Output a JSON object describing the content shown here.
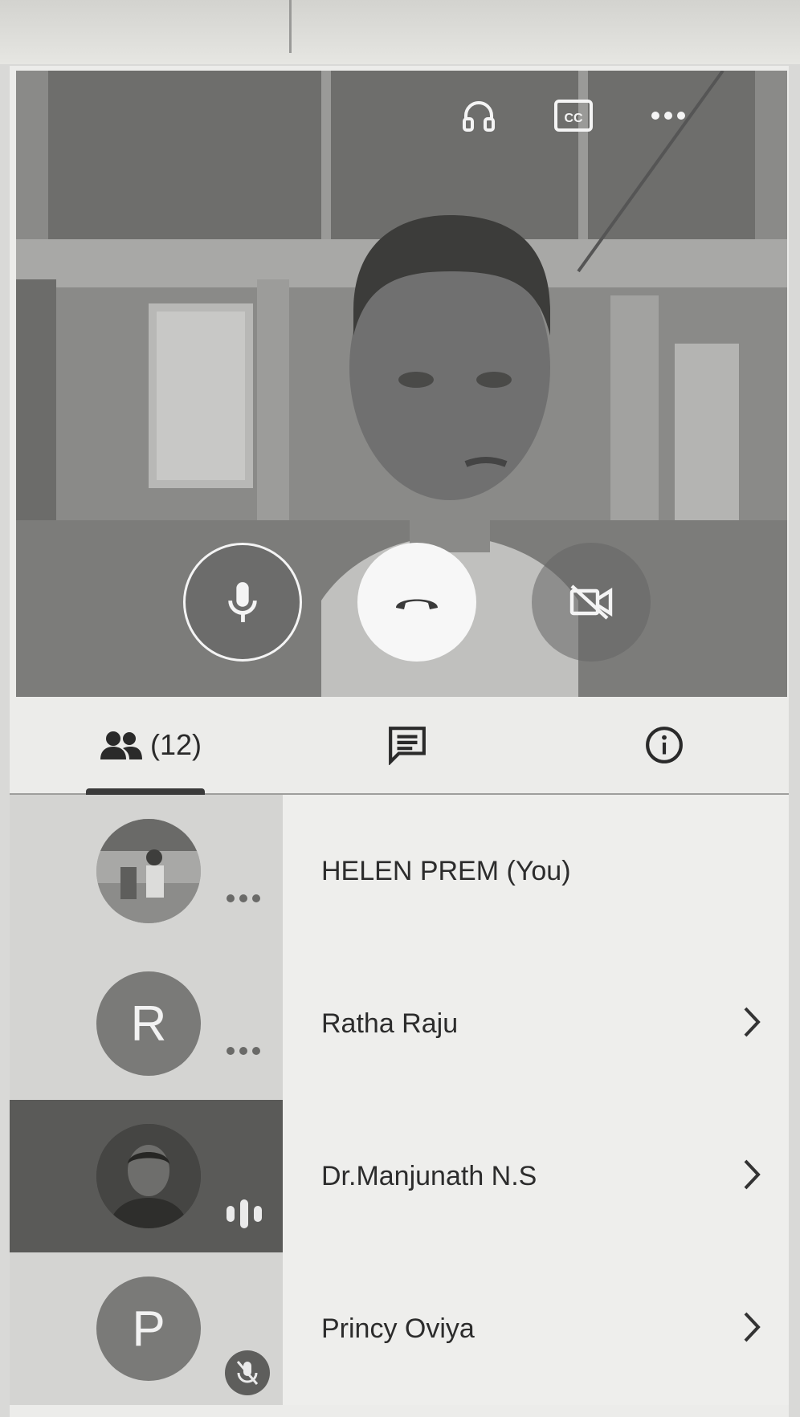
{
  "video": {
    "top_icons": [
      "headphones-icon",
      "closed-captions-icon",
      "more-options-icon"
    ],
    "controls": [
      "microphone-icon",
      "hang-up-icon",
      "video-off-icon"
    ]
  },
  "tabs": {
    "participants_count": "(12)",
    "items": [
      "participants-icon",
      "chat-icon",
      "info-icon"
    ]
  },
  "participants": [
    {
      "name": "HELEN PREM (You)",
      "avatar_type": "photo",
      "indicator": "more-options-icon",
      "chevron": false
    },
    {
      "name": "Ratha Raju",
      "avatar_letter": "R",
      "indicator": "more-options-icon",
      "chevron": true
    },
    {
      "name": "Dr.Manjunath N.S",
      "avatar_type": "photo",
      "indicator": "speaking-icon",
      "chevron": true,
      "active": true
    },
    {
      "name": "Princy Oviya",
      "avatar_letter": "P",
      "indicator": "muted-mic-icon",
      "chevron": true
    }
  ],
  "colors": {
    "active_row": "#5a5a58",
    "hang_up_button": "#f7f7f7"
  }
}
